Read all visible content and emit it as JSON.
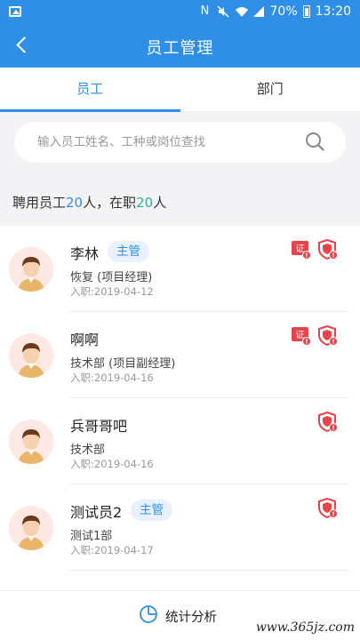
{
  "statusbar": {
    "battery": "70%",
    "time": "13:20"
  },
  "header": {
    "title": "员工管理"
  },
  "tabs": [
    {
      "label": "员工",
      "active": true
    },
    {
      "label": "部门",
      "active": false
    }
  ],
  "search": {
    "placeholder": "输入员工姓名、工种或岗位查找"
  },
  "summary": {
    "prefix": "聘用员工",
    "hired": "20",
    "mid": "人，在职",
    "active": "20",
    "suffix": "人"
  },
  "employees": [
    {
      "name": "李林",
      "badge": "主管",
      "dept": "恢复 (项目经理)",
      "date": "入职:2019-04-12",
      "icons": [
        "cert-warning-icon",
        "shield-warning-icon"
      ]
    },
    {
      "name": "啊啊",
      "badge": "",
      "dept": "技术部 (项目副经理)",
      "date": "入职:2019-04-16",
      "icons": [
        "cert-warning-icon",
        "shield-warning-icon"
      ]
    },
    {
      "name": "兵哥哥吧",
      "badge": "",
      "dept": "技术部",
      "date": "入职:2019-04-16",
      "icons": [
        "shield-warning-icon"
      ]
    },
    {
      "name": "测试员2",
      "badge": "主管",
      "dept": "测试1部",
      "date": "入职:2019-04-17",
      "icons": [
        "shield-warning-icon"
      ]
    }
  ],
  "bottom": {
    "stats_label": "统计分析"
  },
  "watermark": "www.365jz.com",
  "colors": {
    "primary": "#2f8fe6",
    "accent_green": "#2bb39a",
    "warning_red": "#e6434b"
  }
}
